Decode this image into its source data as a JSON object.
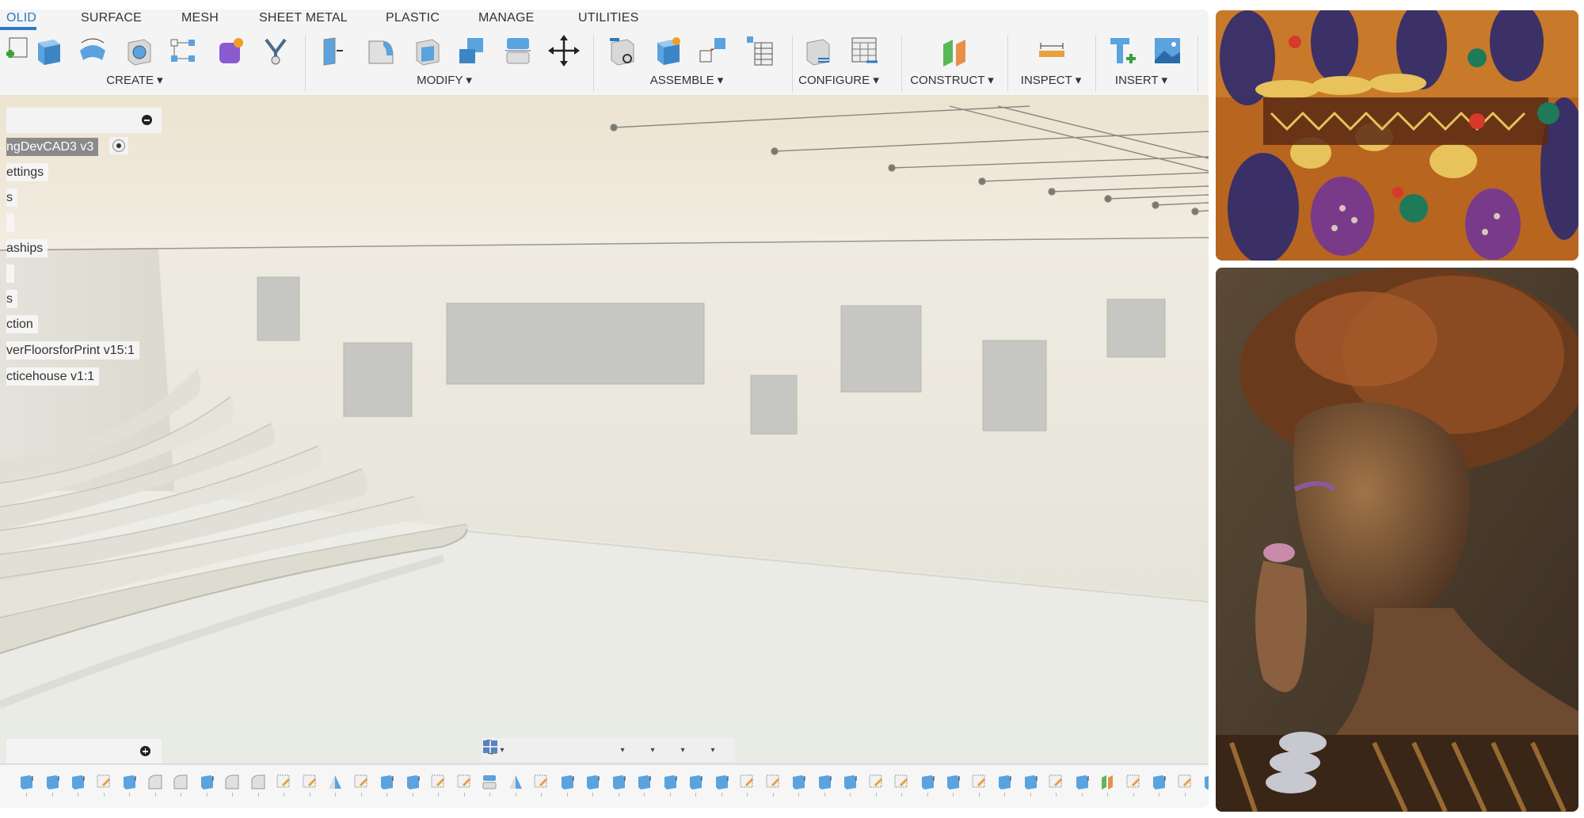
{
  "tabs": [
    {
      "label": "OLID",
      "active": true
    },
    {
      "label": "SURFACE"
    },
    {
      "label": "MESH"
    },
    {
      "label": "SHEET METAL"
    },
    {
      "label": "PLASTIC"
    },
    {
      "label": "MANAGE"
    },
    {
      "label": "UTILITIES"
    }
  ],
  "groups": [
    {
      "label": "CREATE ▾",
      "icons": [
        "sketch-plus-icon",
        "extrude-icon",
        "revolve-icon",
        "hole-icon",
        "pattern-icon",
        "form-icon",
        "fusion-icon"
      ]
    },
    {
      "label": "MODIFY ▾",
      "icons": [
        "press-pull-icon",
        "fillet-icon",
        "shell-icon",
        "combine-icon",
        "split-body-icon",
        "move-icon"
      ]
    },
    {
      "label": "ASSEMBLE ▾",
      "icons": [
        "insert-derive-icon",
        "new-component-icon",
        "joint-icon",
        "bom-table-icon"
      ]
    },
    {
      "label": "CONFIGURE ▾",
      "icons": [
        "configure-body-icon",
        "configure-table-icon"
      ]
    },
    {
      "label": "CONSTRUCT ▾",
      "icons": [
        "offset-plane-icon"
      ]
    },
    {
      "label": "INSPECT ▾",
      "icons": [
        "measure-icon"
      ]
    },
    {
      "label": "INSERT ▾",
      "icons": [
        "insert-mcmaster-icon",
        "insert-canvas-icon"
      ]
    }
  ],
  "browser": {
    "items": [
      {
        "label": "ngDevCAD3 v3",
        "active": true
      },
      {
        "label": "ettings"
      },
      {
        "label": "s"
      },
      {
        "label": " "
      },
      {
        "label": "aships"
      },
      {
        "label": " "
      },
      {
        "label": "s"
      },
      {
        "label": "ction"
      },
      {
        "label": "verFloorsforPrint v15:1"
      },
      {
        "label": "cticehouse v1:1"
      }
    ]
  },
  "navbar": [
    "orbit-icon",
    "look-at-icon",
    "pan-icon",
    "zoom-icon",
    "zoom-window-icon",
    "display-settings-icon",
    "visual-style-icon",
    "viewports-icon"
  ],
  "timeline": [
    "extrude",
    "extrude",
    "extrude",
    "sketch",
    "extrude",
    "fillet",
    "fillet",
    "extrude",
    "fillet",
    "fillet",
    "sketch",
    "sketch",
    "draft",
    "sketch",
    "extrude",
    "extrude",
    "sketch",
    "sketch",
    "split",
    "draft",
    "sketch",
    "extrude",
    "extrude",
    "extrude",
    "extrude",
    "extrude",
    "extrude",
    "extrude",
    "sketch",
    "sketch",
    "extrude",
    "extrude",
    "extrude",
    "sketch",
    "sketch",
    "extrude",
    "extrude",
    "sketch",
    "extrude",
    "extrude",
    "sketch",
    "extrude",
    "construct",
    "sketch",
    "extrude",
    "sketch",
    "extrude",
    "extrude",
    "link",
    "sketch",
    "link"
  ],
  "colors": {
    "accent": "#2a7bc4",
    "icon_blue": "#5aa3de",
    "wall": "#ebe8de",
    "ceiling": "#ede6d6",
    "floor": "#eceee6",
    "frame": "#c4c4c0"
  }
}
